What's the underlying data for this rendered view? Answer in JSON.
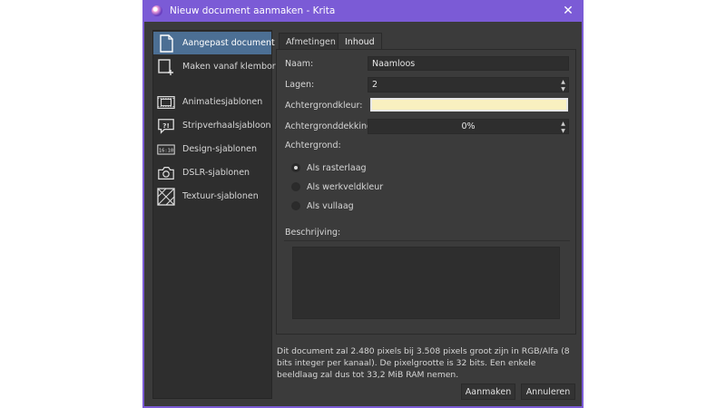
{
  "window": {
    "title": "Nieuw document aanmaken - Krita"
  },
  "sidebar": {
    "items": [
      {
        "label": "Aangepast document",
        "icon": "document-icon",
        "selected": true
      },
      {
        "label": "Maken vanaf klembord",
        "icon": "clipboard-icon"
      },
      {
        "label": "Animatiesjablonen",
        "icon": "film-icon"
      },
      {
        "label": "Stripverhaalsjabloon",
        "icon": "speech-bubble-icon",
        "icon_text": "?!"
      },
      {
        "label": "Design-sjablonen",
        "icon": "ratio-icon",
        "icon_text": "16:10"
      },
      {
        "label": "DSLR-sjablonen",
        "icon": "camera-icon"
      },
      {
        "label": "Textuur-sjablonen",
        "icon": "texture-icon"
      }
    ]
  },
  "tabs": [
    {
      "label": "Afmetingen",
      "active": false
    },
    {
      "label": "Inhoud",
      "active": true
    }
  ],
  "content": {
    "name_label": "Naam:",
    "name_value": "Naamloos",
    "layers_label": "Lagen:",
    "layers_value": "2",
    "bg_color_label": "Achtergrondkleur:",
    "bg_color": "#f9f0c0",
    "bg_opacity_label": "Achtergronddekking:",
    "bg_opacity_value": "0%",
    "background_label": "Achtergrond:",
    "background_options": [
      {
        "label": "Als rasterlaag",
        "checked": true
      },
      {
        "label": "Als werkveldkleur",
        "checked": false
      },
      {
        "label": "Als vullaag",
        "checked": false
      }
    ],
    "description_label": "Beschrijving:"
  },
  "info": "Dit document zal 2.480 pixels bij 3.508 pixels groot zijn in RGB/Alfa (8 bits integer per kanaal). De pixelgrootte is 32 bits. Een enkele beeldlaag zal dus tot 33,2 MiB RAM nemen.",
  "buttons": {
    "create": "Aanmaken",
    "cancel": "Annuleren"
  },
  "colors": {
    "accent": "#7b5bd6",
    "selection": "#4c6f94",
    "background": "#3b3b3b"
  }
}
